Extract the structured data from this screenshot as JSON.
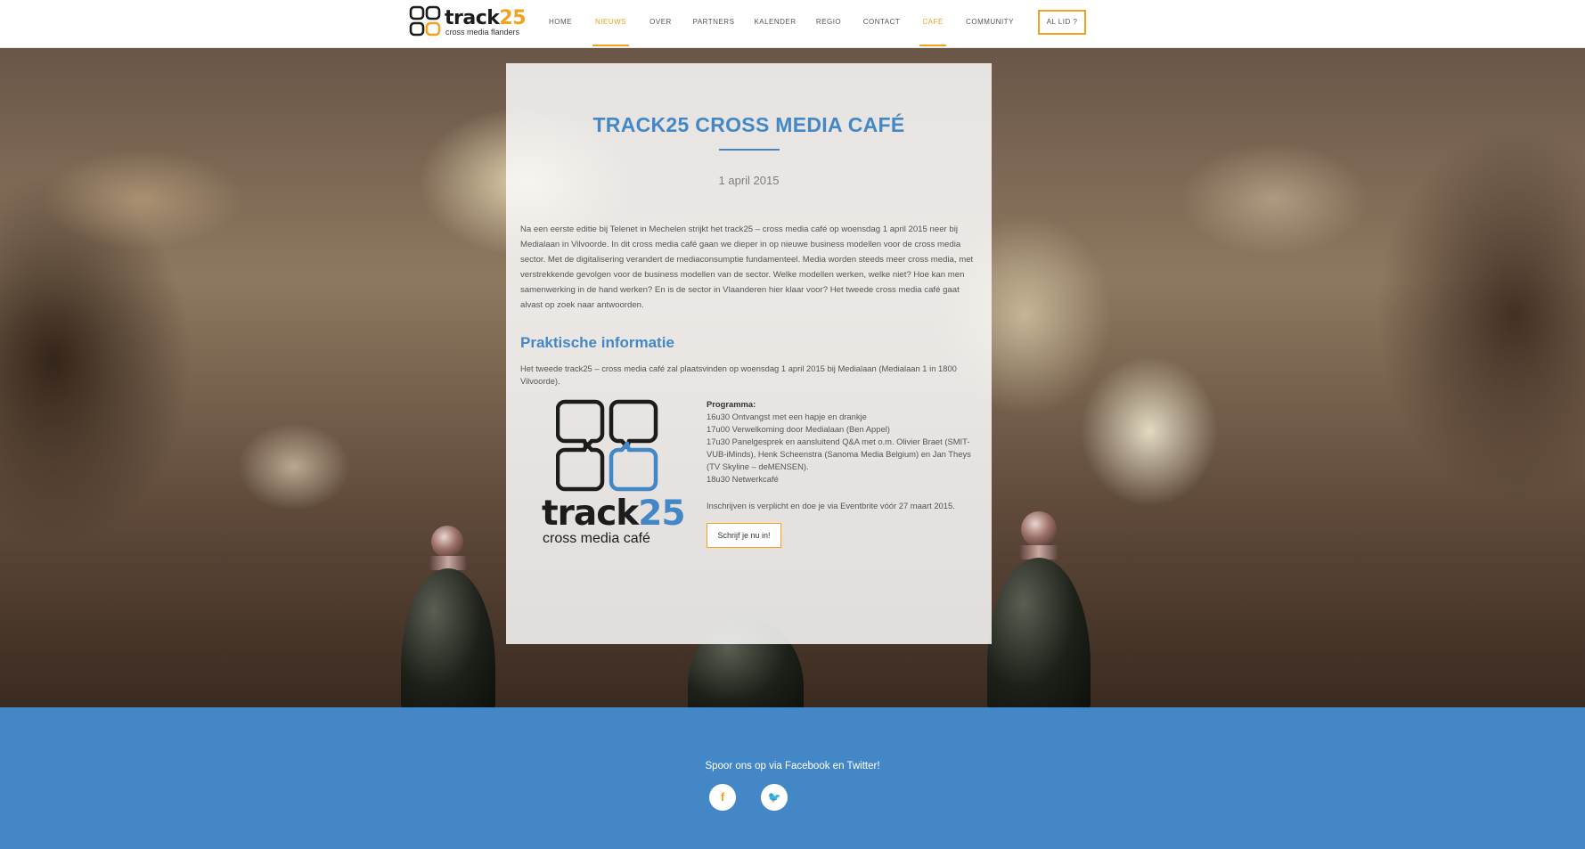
{
  "brand": {
    "logo_word_main": "track",
    "logo_word_accent": "25",
    "logo_subtitle": "cross media flanders",
    "accent_color": "#f2a21f",
    "primary_color": "#4487c7"
  },
  "nav": {
    "items": [
      {
        "label": "HOME",
        "active": false
      },
      {
        "label": "NIEUWS",
        "active": true
      },
      {
        "label": "OVER",
        "active": false
      },
      {
        "label": "PARTNERS",
        "active": false
      },
      {
        "label": "KALENDER",
        "active": false
      },
      {
        "label": "REGIO",
        "active": false
      },
      {
        "label": "CONTACT",
        "active": false
      },
      {
        "label": "CAFÉ",
        "active": true
      },
      {
        "label": "COMMUNITY",
        "active": false
      }
    ],
    "cta_label": "AL LID ?"
  },
  "article": {
    "title": "TRACK25 CROSS MEDIA CAFÉ",
    "date": "1 april 2015",
    "intro": "Na een eerste editie bij Telenet in Mechelen strijkt het track25 – cross media café op woensdag 1 april 2015 neer bij Medialaan in Vilvoorde. In dit cross media café gaan we dieper in op nieuwe business modellen voor de cross media sector. Met de digitalisering verandert de mediaconsumptie fundamenteel. Media worden steeds meer cross media, met verstrekkende gevolgen voor de business modellen van de sector. Welke modellen werken, welke niet? Hoe kan men samenwerking in de hand werken? En is de sector in Vlaanderen hier klaar voor? Het tweede cross media café gaat alvast op zoek naar antwoorden.",
    "section_heading": "Praktische informatie",
    "section_text": "Het tweede track25 – cross media café zal plaatsvinden op woensdag 1 april 2015 bij Medialaan (Medialaan 1 in 1800 Vilvoorde).",
    "cafe_logo": {
      "word_main": "track",
      "word_accent": "25",
      "subtitle": "cross media café"
    },
    "program": {
      "title": "Programma:",
      "lines": [
        "16u30  Ontvangst met een hapje en drankje",
        "17u00  Verwelkoming door Medialaan (Ben Appel)",
        "17u30 Panelgesprek en aansluitend Q&A met o.m. Olivier Braet (SMIT-VUB-iMinds), Henk Scheenstra (Sanoma Media Belgium) en Jan Theys (TV Skyline – deMENSEN).",
        "18u30  Netwerkcafé"
      ]
    },
    "register_text": "Inschrijven is verplicht en doe je via Eventbrite vóór 27 maart 2015.",
    "register_button": "Schrijf je nu in!"
  },
  "footer": {
    "text": "Spoor ons op via Facebook en Twitter!",
    "social": [
      {
        "icon": "facebook-icon",
        "glyph": "f"
      },
      {
        "icon": "twitter-icon",
        "glyph": "🐦"
      }
    ]
  }
}
